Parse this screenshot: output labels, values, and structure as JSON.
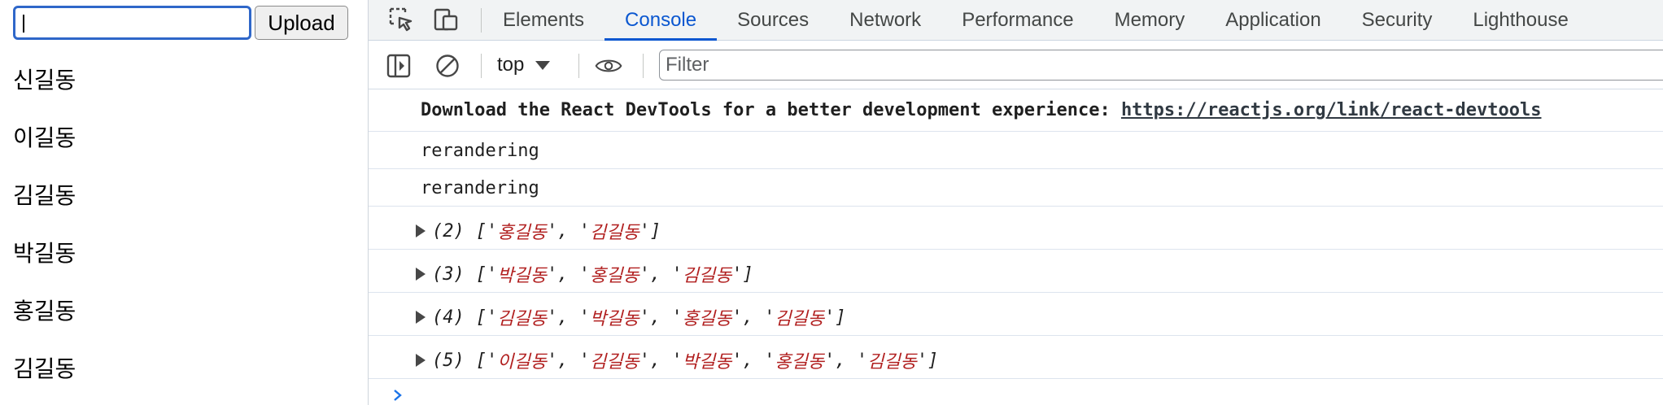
{
  "app": {
    "input": {
      "value": "",
      "placeholder": ""
    },
    "upload_label": "Upload",
    "names": [
      "신길동",
      "이길동",
      "김길동",
      "박길동",
      "홍길동",
      "김길동"
    ]
  },
  "devtools": {
    "tabs": [
      "Elements",
      "Console",
      "Sources",
      "Network",
      "Performance",
      "Memory",
      "Application",
      "Security",
      "Lighthouse"
    ],
    "active_tab": "Console",
    "context": "top",
    "filter_placeholder": "Filter",
    "messages": {
      "devtools_hint_text": "Download the React DevTools for a better development experience: ",
      "devtools_hint_link": "https://reactjs.org/link/react-devtools",
      "log1": "rerandering",
      "log2": "rerandering"
    },
    "arrays": [
      {
        "count": "(2)",
        "items": [
          "홍길동",
          "김길동"
        ]
      },
      {
        "count": "(3)",
        "items": [
          "박길동",
          "홍길동",
          "김길동"
        ]
      },
      {
        "count": "(4)",
        "items": [
          "김길동",
          "박길동",
          "홍길동",
          "김길동"
        ]
      },
      {
        "count": "(5)",
        "items": [
          "이길동",
          "김길동",
          "박길동",
          "홍길동",
          "김길동"
        ]
      }
    ],
    "colors": {
      "accent": "#0b57d0",
      "string": "#b11f1f",
      "prompt": "#1a73e8"
    }
  }
}
